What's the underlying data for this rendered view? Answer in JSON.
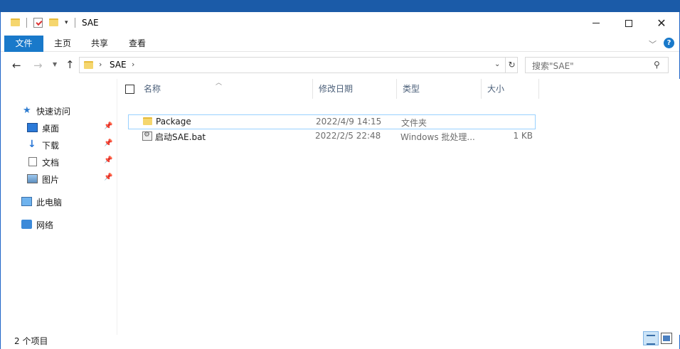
{
  "window": {
    "title": "SAE",
    "buttons": {
      "minimize": "minimize",
      "maximize": "maximize",
      "close": "✕"
    }
  },
  "ribbon": {
    "tabs": [
      {
        "label": "文件"
      },
      {
        "label": "主页"
      },
      {
        "label": "共享"
      },
      {
        "label": "查看"
      }
    ],
    "help": "?"
  },
  "address": {
    "segments": [
      "SAE"
    ],
    "separator": "›"
  },
  "search": {
    "placeholder": "搜索\"SAE\""
  },
  "nav_pane": {
    "quick_access": "快速访问",
    "items": [
      {
        "label": "桌面",
        "icon": "desktop-icon",
        "pinned": true
      },
      {
        "label": "下载",
        "icon": "download-icon",
        "pinned": true
      },
      {
        "label": "文档",
        "icon": "documents-icon",
        "pinned": true
      },
      {
        "label": "图片",
        "icon": "pictures-icon",
        "pinned": true
      }
    ],
    "this_pc": "此电脑",
    "network": "网络"
  },
  "columns": {
    "name": "名称",
    "date": "修改日期",
    "type": "类型",
    "size": "大小"
  },
  "files": [
    {
      "name": "Package",
      "date": "2022/4/9 14:15",
      "type": "文件夹",
      "size": "",
      "icon": "folder-icon",
      "selected": true
    },
    {
      "name": "启动SAE.bat",
      "date": "2022/2/5 22:48",
      "type": "Windows 批处理...",
      "size": "1 KB",
      "icon": "batch-file-icon",
      "selected": false
    }
  ],
  "status": {
    "item_count": "2 个项目"
  },
  "colors": {
    "accent": "#1979ca",
    "desktop_bg": "#1b5ba8",
    "selection_border": "#99d1ff",
    "folder": "#f5d66e"
  }
}
